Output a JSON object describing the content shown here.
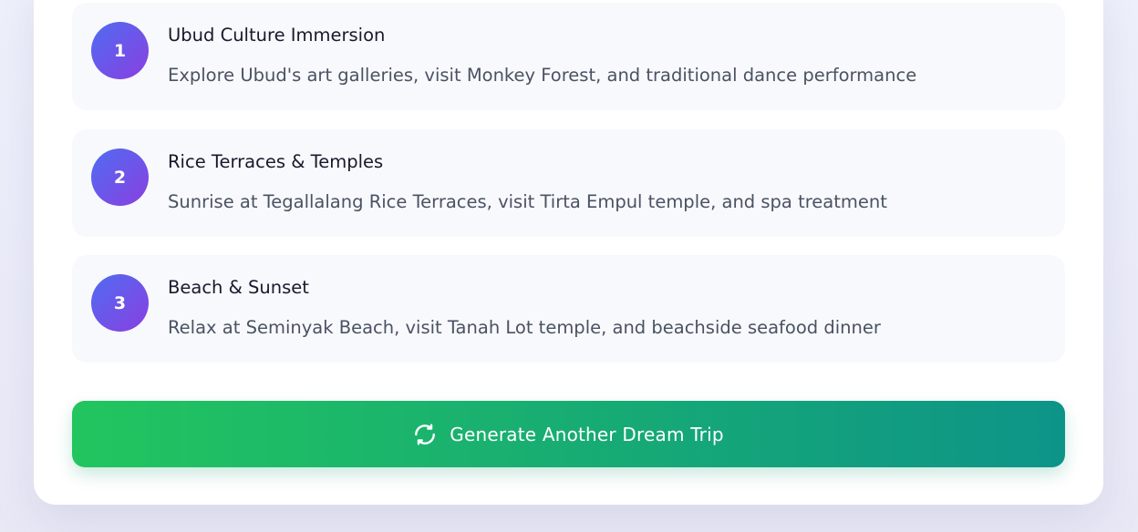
{
  "itinerary": {
    "days": [
      {
        "number": "1",
        "title": "Ubud Culture Immersion",
        "description": "Explore Ubud's art galleries, visit Monkey Forest, and traditional dance performance"
      },
      {
        "number": "2",
        "title": "Rice Terraces & Temples",
        "description": "Sunrise at Tegallalang Rice Terraces, visit Tirta Empul temple, and spa treatment"
      },
      {
        "number": "3",
        "title": "Beach & Sunset",
        "description": "Relax at Seminyak Beach, visit Tanah Lot temple, and beachside seafood dinner"
      }
    ]
  },
  "actions": {
    "generate_label": "Generate Another Dream Trip",
    "generate_icon": "refresh-icon"
  },
  "colors": {
    "badge_gradient": [
      "#4f6cf2",
      "#8a3fe0"
    ],
    "button_gradient": [
      "#22c55e",
      "#0d9488"
    ]
  }
}
